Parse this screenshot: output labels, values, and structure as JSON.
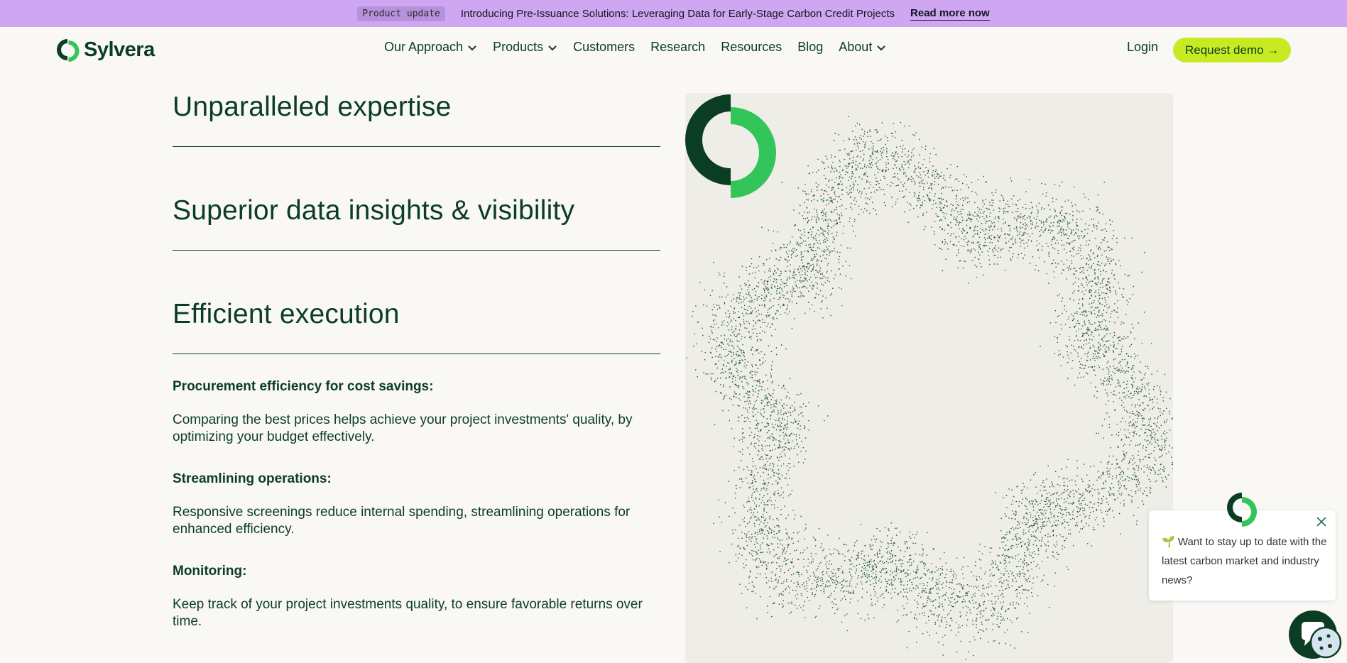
{
  "announcement": {
    "tag": "Product update",
    "message": "Introducing Pre-Issuance Solutions: Leveraging Data for Early-Stage Carbon Credit Projects",
    "link": "Read more now",
    "bg_color": "#cfa6f2"
  },
  "brand": {
    "name": "Sylvera",
    "dark_green": "#0b3d24",
    "bright_green": "#33c45a",
    "accent_lime": "#c8ea23"
  },
  "nav": {
    "items": [
      {
        "label": "Our Approach",
        "has_dropdown": true
      },
      {
        "label": "Products",
        "has_dropdown": true
      },
      {
        "label": "Customers",
        "has_dropdown": false
      },
      {
        "label": "Research",
        "has_dropdown": false
      },
      {
        "label": "Resources",
        "has_dropdown": false
      },
      {
        "label": "Blog",
        "has_dropdown": false
      },
      {
        "label": "About",
        "has_dropdown": true
      }
    ],
    "login": "Login",
    "cta": "Request demo →"
  },
  "features": {
    "heading_1": "Unparalleled expertise",
    "heading_2": "Superior data insights & visibility",
    "heading_3": "Efficient execution",
    "details": [
      {
        "title": "Procurement efficiency for cost savings:",
        "text": "Comparing the best prices helps achieve your project investments' quality, by optimizing your budget effectively."
      },
      {
        "title": "Streamlining operations:",
        "text": "Responsive screenings reduce internal spending, streamlining operations for enhanced efficiency."
      },
      {
        "title": "Monitoring:",
        "text": "Keep track of your project investments quality, to ensure favorable returns over time."
      }
    ]
  },
  "chat": {
    "message": "🌱 Want to stay up to date with the latest carbon market and industry news?"
  },
  "icons": {
    "chevron": "chevron-down-icon",
    "close": "close-icon",
    "chat": "chat-bubble-icon",
    "cookie": "cookie-icon"
  }
}
